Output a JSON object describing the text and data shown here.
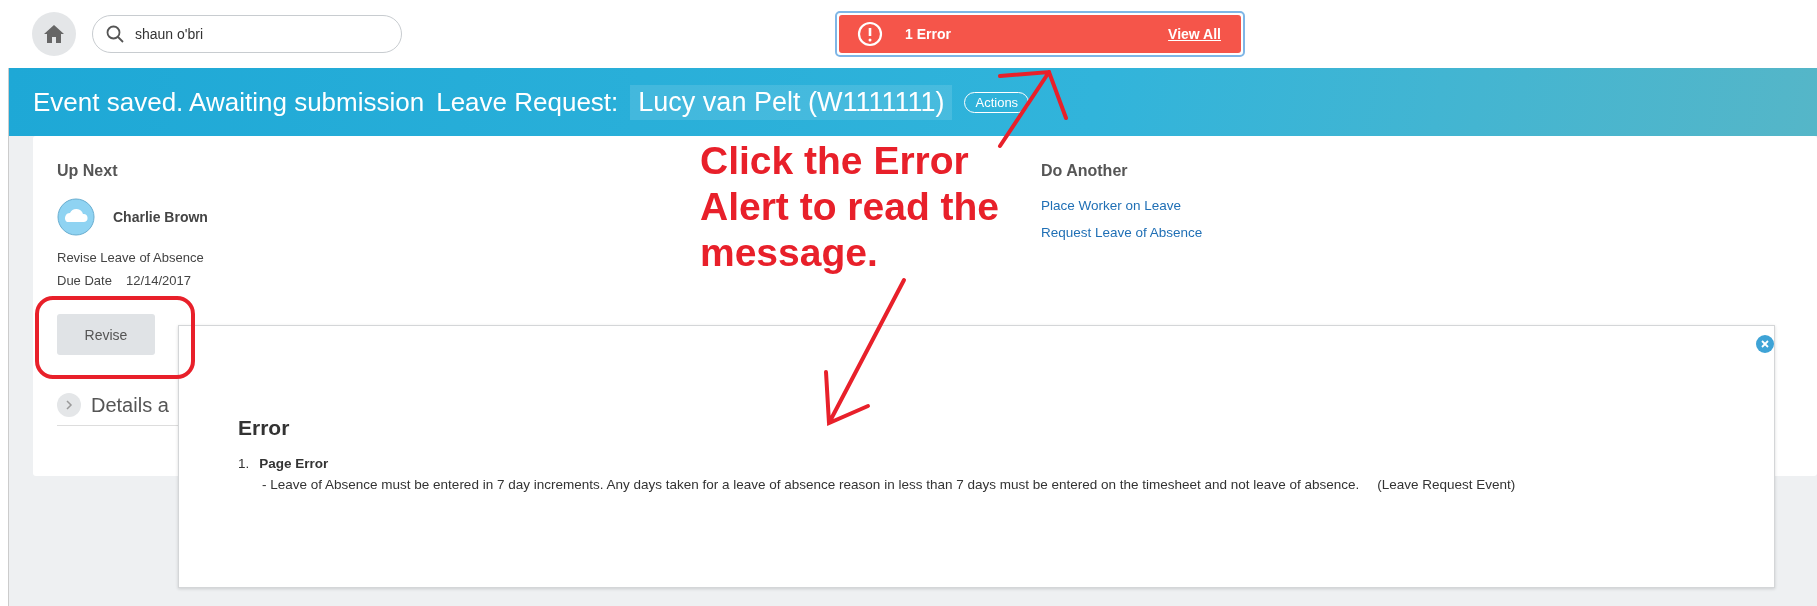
{
  "search": {
    "value": "shaun o'bri"
  },
  "error_alert": {
    "count": "1 Error",
    "link": "View All"
  },
  "banner": {
    "status": "Event saved. Awaiting submission",
    "label": "Leave Request:",
    "subject": "Lucy van Pelt (W1111111)",
    "actions": "Actions"
  },
  "up_next": {
    "heading": "Up Next",
    "person": "Charlie Brown",
    "task": "Revise Leave of Absence",
    "due_label": "Due Date",
    "due_date": "12/14/2017",
    "button": "Revise"
  },
  "details": {
    "title": "Details a",
    "expanded": false
  },
  "do_another": {
    "heading": "Do Another",
    "links": [
      "Place Worker on Leave",
      "Request Leave of Absence"
    ]
  },
  "error_panel": {
    "title": "Error",
    "items": [
      {
        "number": "1.",
        "title": "Page Error",
        "message": "- Leave of Absence must be entered in 7 day increments. Any days taken for a leave of absence reason in less than 7 days must be entered on the timesheet and not leave of absence.",
        "source": "(Leave Request Event)"
      }
    ]
  },
  "annotation": {
    "lines": [
      "Click the Error",
      "Alert to read the",
      "message."
    ]
  }
}
